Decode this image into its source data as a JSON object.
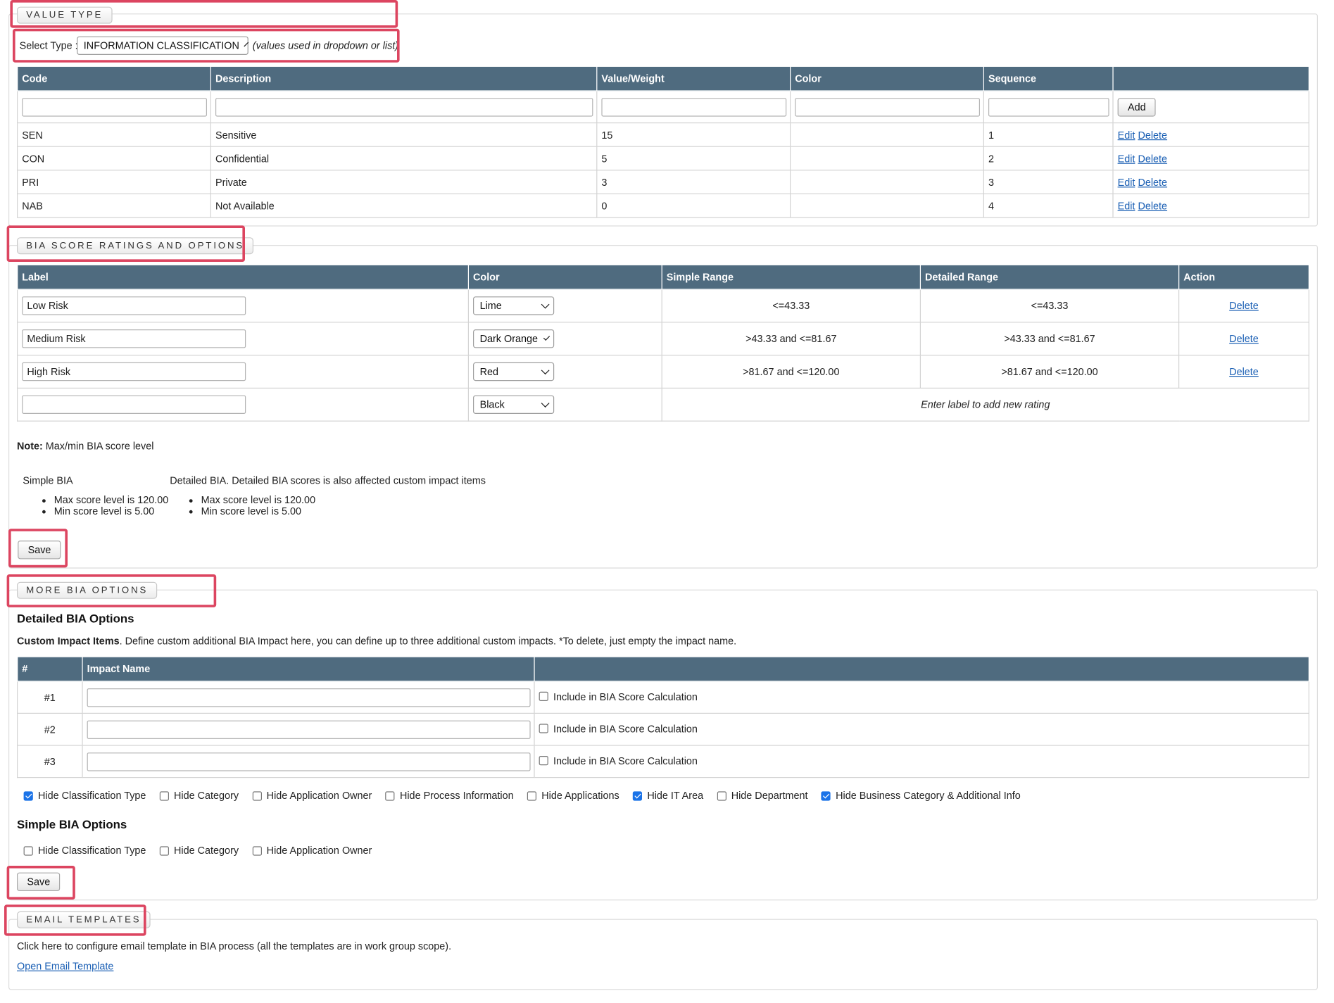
{
  "value_type": {
    "legend": "VALUE TYPE",
    "select_label": "Select Type :",
    "select_value": "INFORMATION CLASSIFICATION",
    "select_hint": "(values used in dropdown or list)",
    "columns": [
      "Code",
      "Description",
      "Value/Weight",
      "Color",
      "Sequence",
      ""
    ],
    "add_label": "Add",
    "edit_label": "Edit",
    "delete_label": "Delete",
    "rows": [
      {
        "code": "SEN",
        "description": "Sensitive",
        "weight": "15",
        "color": "",
        "sequence": "1"
      },
      {
        "code": "CON",
        "description": "Confidential",
        "weight": "5",
        "color": "",
        "sequence": "2"
      },
      {
        "code": "PRI",
        "description": "Private",
        "weight": "3",
        "color": "",
        "sequence": "3"
      },
      {
        "code": "NAB",
        "description": "Not Available",
        "weight": "0",
        "color": "",
        "sequence": "4"
      }
    ]
  },
  "bia_score": {
    "legend": "BIA SCORE RATINGS AND OPTIONS",
    "columns": [
      "Label",
      "Color",
      "Simple Range",
      "Detailed Range",
      "Action"
    ],
    "delete_label": "Delete",
    "rows": [
      {
        "label": "Low Risk",
        "color": "Lime",
        "simple": "<=43.33",
        "detailed": "<=43.33"
      },
      {
        "label": "Medium Risk",
        "color": "Dark Orange",
        "simple": ">43.33 and <=81.67",
        "detailed": ">43.33 and <=81.67"
      },
      {
        "label": "High Risk",
        "color": "Red",
        "simple": ">81.67 and <=120.00",
        "detailed": ">81.67 and <=120.00"
      }
    ],
    "new_row": {
      "label": "",
      "color": "Black",
      "hint": "Enter label to add new rating"
    },
    "note_label": "Note:",
    "note_text": " Max/min BIA score level",
    "simple_title": "Simple BIA",
    "simple_items": [
      "Max score level is 120.00",
      "Min score level is 5.00"
    ],
    "detailed_title": "Detailed BIA. Detailed BIA scores is also affected custom impact items",
    "detailed_items": [
      "Max score level is 120.00",
      "Min score level is 5.00"
    ],
    "save_label": "Save"
  },
  "more_bia": {
    "legend": "MORE BIA OPTIONS",
    "detailed_heading": "Detailed BIA Options",
    "custom_label": "Custom Impact Items",
    "custom_desc": ". Define custom additional BIA Impact here, you can define up to three additional custom impacts. *To delete, just empty the impact name.",
    "columns": [
      "#",
      "Impact Name",
      ""
    ],
    "include_label": "Include in BIA Score Calculation",
    "impacts": [
      {
        "num": "#1",
        "name": "",
        "include": false
      },
      {
        "num": "#2",
        "name": "",
        "include": false
      },
      {
        "num": "#3",
        "name": "",
        "include": false
      }
    ],
    "detailed_options": [
      {
        "label": "Hide Classification Type",
        "checked": true
      },
      {
        "label": "Hide Category",
        "checked": false
      },
      {
        "label": "Hide Application Owner",
        "checked": false
      },
      {
        "label": "Hide Process Information",
        "checked": false
      },
      {
        "label": "Hide Applications",
        "checked": false
      },
      {
        "label": "Hide IT Area",
        "checked": true
      },
      {
        "label": "Hide Department",
        "checked": false
      },
      {
        "label": "Hide Business Category & Additional Info",
        "checked": true
      }
    ],
    "simple_heading": "Simple BIA Options",
    "simple_options": [
      {
        "label": "Hide Classification Type",
        "checked": false
      },
      {
        "label": "Hide Category",
        "checked": false
      },
      {
        "label": "Hide Application Owner",
        "checked": false
      }
    ],
    "save_label": "Save"
  },
  "email": {
    "legend": "EMAIL TEMPLATES",
    "text": "Click here to configure email template in BIA process (all the templates are in work group scope).",
    "link": "Open Email Template"
  },
  "colors": {
    "header_bg": "#4f6b7f",
    "highlight": "#dc4560",
    "link": "#1a5fb4",
    "checkbox_checked": "#1a73e8"
  }
}
